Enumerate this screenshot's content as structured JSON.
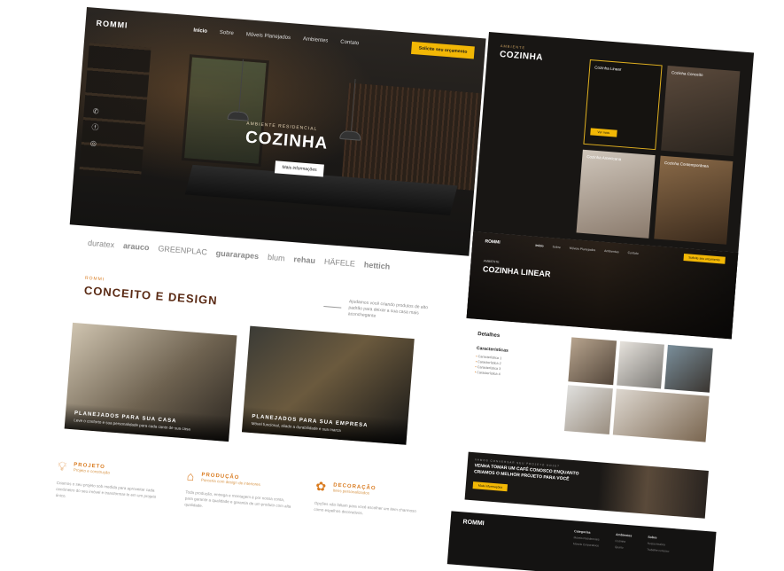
{
  "hero": {
    "logo": "ROMMI",
    "nav": [
      "Início",
      "Sobre",
      "Móveis Planejados",
      "Ambientes",
      "Contato"
    ],
    "cta": "Solicite seu orçamento",
    "subtitle": "AMBIENTE RESIDENCIAL",
    "title": "COZINHA",
    "button": "Mais informações"
  },
  "brands": [
    "duratex",
    "arauco",
    "GREENPLAC",
    "guararapes",
    "blum",
    "rehau",
    "HÄFELE",
    "hettich"
  ],
  "concept": {
    "eyebrow": "ROMMI",
    "title": "CONCEITO E DESIGN",
    "desc": "Ajudamos você criando produtos de alto padrão para deixar a sua casa mais aconchegante"
  },
  "cards": [
    {
      "title": "PLANEJADOS PARA SUA CASA",
      "desc": "Leve o conforto e sua personalidade para cada canto de sua casa"
    },
    {
      "title": "PLANEJADOS PARA SUA EMPRESA",
      "desc": "Móvel funcional, aliado a durabilidade e sua marca"
    }
  ],
  "services": [
    {
      "title": "PROJETO",
      "sub": "Projeto e construção",
      "desc": "Criamos o seu projeto sob medida para aproveitar cada centímetro do seu imóvel e transformar-lo em um projeto único."
    },
    {
      "title": "PRODUÇÃO",
      "sub": "Parceria com design de interiores",
      "desc": "Toda produção, entrega e montagem é por nossa conta, para garantir a qualidade e garantia de um produto com alta qualidade."
    },
    {
      "title": "DECORAÇÃO",
      "sub": "Itens personalizados",
      "desc": "Opções não faltam para você escolher um item charmoso como espelhos decorativos."
    }
  ],
  "right": {
    "eyebrow": "AMBIENTE",
    "title": "COZINHA",
    "tiles": [
      {
        "label": "Cozinha Linear",
        "button": "Ver mais"
      },
      {
        "label": "Cozinha Conceito"
      },
      {
        "label": "Cozinha Americana"
      },
      {
        "label": "Cozinha Contemporânea"
      }
    ],
    "nav": [
      "Início",
      "Sobre",
      "Móveis Planejados",
      "Ambientes",
      "Contato"
    ],
    "cta": "Solicite seu orçamento",
    "eyebrow2": "AMBIENTE",
    "title2": "COZINHA LINEAR",
    "details_title": "Detalhes",
    "characteristics_title": "Características",
    "characteristics": [
      "Característica 1",
      "Característica 2",
      "Característica 3",
      "Característica 4"
    ],
    "coffee_eyebrow": "VAMOS CONVERSAR SEU PROJETO HOJE?",
    "coffee_title": "VENHA TOMAR UM CAFÉ CONOSCO ENQUANTO CRIAMOS O MELHOR PROJETO PARA VOCÊ",
    "coffee_button": "Mais informações",
    "footer_logo": "ROMMI",
    "footer_cols": [
      {
        "head": "Categorias",
        "items": [
          "Móveis Residenciais",
          "Móveis Corporativos"
        ]
      },
      {
        "head": "Ambientes",
        "items": [
          "Cozinha",
          "Quarto"
        ]
      },
      {
        "head": "Sobre",
        "items": [
          "Nossa história",
          "Trabalhe conosco"
        ]
      }
    ]
  }
}
